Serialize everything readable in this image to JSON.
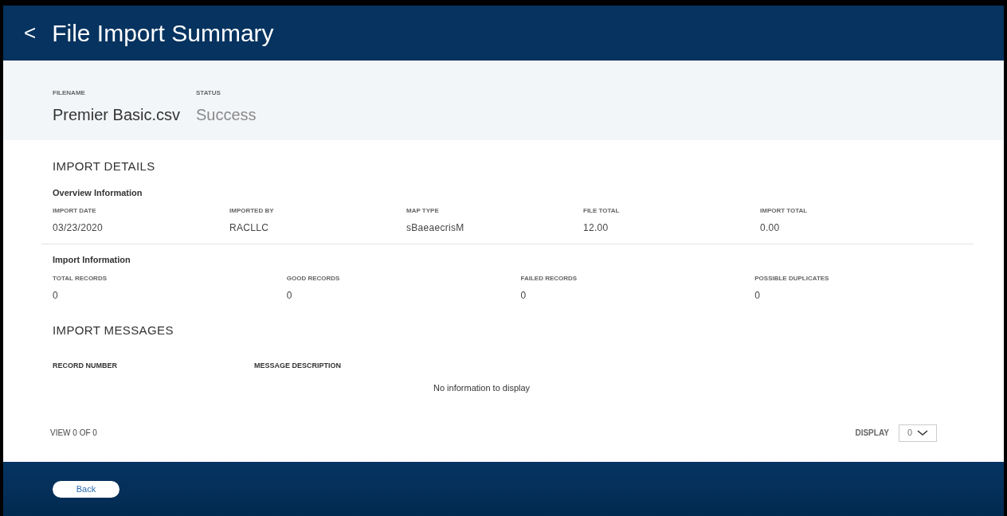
{
  "header": {
    "back_glyph": "<",
    "title": "File Import Summary"
  },
  "summary": [
    {
      "label": "FILENAME",
      "value": "Premier Basic.csv",
      "kind": "name"
    },
    {
      "label": "STATUS",
      "value": "Success",
      "kind": "status"
    }
  ],
  "import_details": {
    "title": "IMPORT DETAILS",
    "overview": {
      "title": "Overview Information",
      "fields": [
        {
          "label": "IMPORT DATE",
          "value": "03/23/2020"
        },
        {
          "label": "IMPORTED BY",
          "value": "RACLLC"
        },
        {
          "label": "MAP TYPE",
          "value": "sBaeaecrisM"
        },
        {
          "label": "FILE TOTAL",
          "value": "12.00"
        },
        {
          "label": "IMPORT TOTAL",
          "value": "0.00"
        }
      ]
    },
    "import_info": {
      "title": "Import Information",
      "fields": [
        {
          "label": "TOTAL RECORDS",
          "value": "0"
        },
        {
          "label": "GOOD RECORDS",
          "value": "0"
        },
        {
          "label": "FAILED RECORDS",
          "value": "0"
        },
        {
          "label": "POSSIBLE DUPLICATES",
          "value": "0"
        }
      ]
    }
  },
  "import_messages": {
    "title": "IMPORT MESSAGES",
    "columns": [
      "RECORD NUMBER",
      "MESSAGE DESCRIPTION"
    ],
    "empty_text": "No information to display"
  },
  "pager": {
    "view_text": "VIEW 0 OF 0",
    "display_label": "DISPLAY",
    "display_value": "0"
  },
  "footer": {
    "back_button": "Back"
  }
}
